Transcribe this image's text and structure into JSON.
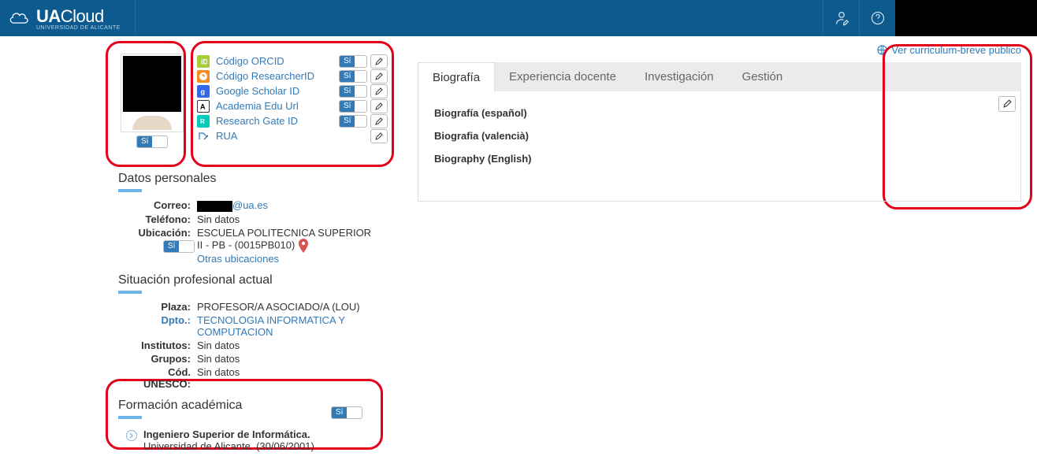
{
  "header": {
    "app_name_bold": "UA",
    "app_name_light": "Cloud",
    "subtitle": "UNIVERSIDAD DE ALICANTE"
  },
  "ids": [
    {
      "key": "orcid",
      "label": "Código ORCID",
      "has_toggle": true
    },
    {
      "key": "researcher",
      "label": "Código ResearcherID",
      "has_toggle": true
    },
    {
      "key": "scholar",
      "label": "Google Scholar ID",
      "has_toggle": true
    },
    {
      "key": "academia",
      "label": "Academia Edu Url",
      "has_toggle": true
    },
    {
      "key": "rgate",
      "label": "Research Gate ID",
      "has_toggle": true
    },
    {
      "key": "rua",
      "label": "RUA",
      "has_toggle": false
    }
  ],
  "toggle_yes": "Sí",
  "sections": {
    "datos": "Datos personales",
    "situacion": "Situación profesional actual",
    "formacion": "Formación académica"
  },
  "datos": {
    "correo_label": "Correo:",
    "correo_suffix": "@ua.es",
    "telefono_label": "Teléfono:",
    "telefono_val": "Sin datos",
    "ubicacion_label": "Ubicación:",
    "ubicacion_val": "ESCUELA POLITECNICA SUPERIOR II - PB - (0015PB010)",
    "otras": "Otras ubicaciones"
  },
  "situacion": {
    "plaza_label": "Plaza:",
    "plaza_val": "PROFESOR/A ASOCIADO/A (LOU)",
    "dpto_label": "Dpto.:",
    "dpto_val": "TECNOLOGIA INFORMATICA Y COMPUTACION",
    "inst_label": "Institutos:",
    "inst_val": "Sin datos",
    "grupos_label": "Grupos:",
    "grupos_val": "Sin datos",
    "unesco_label": "Cód. UNESCO:",
    "unesco_val": "Sin datos"
  },
  "formacion": {
    "title": "Ingeniero Superior de Informática.",
    "subtitle": "Universidad de Alicante. (30/06/2001)"
  },
  "right": {
    "ver_cv": "Ver curriculum-breve público",
    "tabs": [
      "Biografía",
      "Experiencia docente",
      "Investigación",
      "Gestión"
    ],
    "bio_lines": [
      "Biografía (español)",
      "Biografia (valencià)",
      "Biography (English)"
    ]
  }
}
